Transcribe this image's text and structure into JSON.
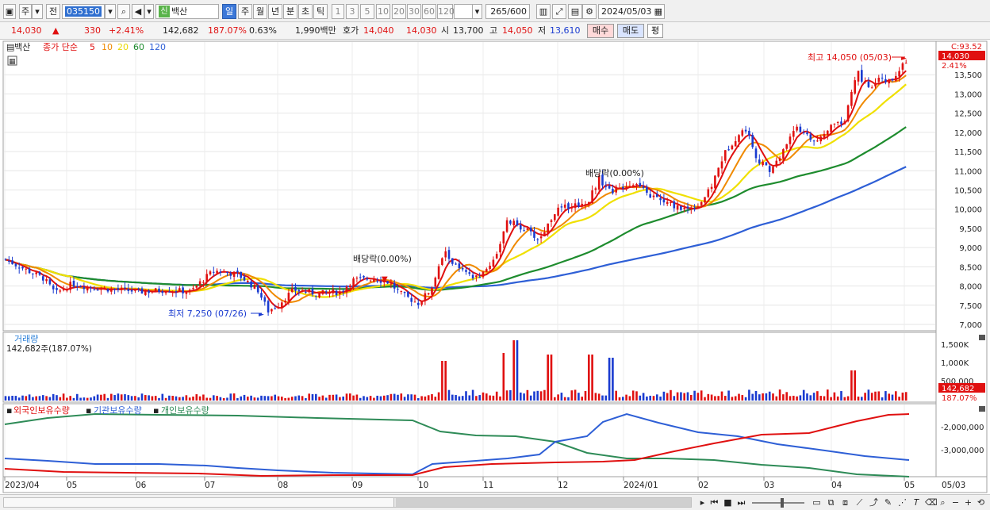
{
  "toolbar": {
    "market": "주",
    "prev_label": "전",
    "stock_code": "035150",
    "sin_badge": "신",
    "stock_name": "백산",
    "periods": [
      "일",
      "주",
      "월",
      "년",
      "분",
      "초",
      "틱"
    ],
    "intervals": [
      "1",
      "3",
      "5",
      "10",
      "20",
      "30",
      "60",
      "120"
    ],
    "count": "265",
    "count_total": "/600",
    "date": "2024/05/03"
  },
  "quote": {
    "price": "14,030",
    "change": "330",
    "change_pct": "+2.41%",
    "volume": "142,682",
    "volume_pct": "187.07%",
    "turnover_pct": "0.63%",
    "amount": "1,990백만",
    "bid_label": "호가",
    "ask": "14,040",
    "bid": "14,030",
    "open_label": "시",
    "open": "13,700",
    "high_label": "고",
    "high": "14,050",
    "low_label": "저",
    "low": "13,610",
    "buy": "매수",
    "sell": "매도",
    "eval": "평"
  },
  "price_panel": {
    "legend_name": "백산",
    "legend_ma": "종가 단순",
    "ma_periods": [
      {
        "label": "5",
        "color": "#e01010"
      },
      {
        "label": "10",
        "color": "#f08a00"
      },
      {
        "label": "20",
        "color": "#e8e000"
      },
      {
        "label": "60",
        "color": "#1e8c2e"
      },
      {
        "label": "120",
        "color": "#2e5fd6"
      }
    ],
    "top_right": "C:93.52",
    "last_price": "14,030",
    "last_pct": "2.41%",
    "y_ticks": [
      "13,500",
      "13,000",
      "12,500",
      "12,000",
      "11,500",
      "11,000",
      "10,500",
      "10,000",
      "9,500",
      "9,000",
      "8,500",
      "8,000",
      "7,500",
      "7,000"
    ],
    "annotations": {
      "high": "최고 14,050 (05/03)",
      "low": "최저 7,250 (07/26)",
      "dividend1": "배당락(0.00%)",
      "dividend2": "배당락(0.00%)"
    }
  },
  "volume_panel": {
    "title": "거래량",
    "subtitle": "142,682주(187.07%)",
    "y_ticks": [
      "1,500K",
      "1,000K",
      "500,000"
    ],
    "last_value": "142,682",
    "last_pct": "187.07%"
  },
  "holdings_panel": {
    "legend": [
      {
        "label": "외국인보유수량",
        "color": "#e01010"
      },
      {
        "label": "기관보유수량",
        "color": "#2e5fd6"
      },
      {
        "label": "개인보유수량",
        "color": "#2e8b57"
      }
    ],
    "y_ticks": [
      "-2,000,000",
      "-3,000,000"
    ]
  },
  "x_axis": {
    "labels": [
      "2023/04",
      "05",
      "06",
      "07",
      "08",
      "09",
      "10",
      "11",
      "12",
      "2024/01",
      "02",
      "03",
      "04",
      "05"
    ],
    "right_label": "05/03"
  },
  "colors": {
    "up": "#e01010",
    "down": "#1a3bd0",
    "ma5": "#e01010",
    "ma10": "#f08a00",
    "ma20": "#f0e000",
    "ma60": "#1e8c2e",
    "ma120": "#2e5fd6",
    "accent": "#3c78d8"
  }
}
